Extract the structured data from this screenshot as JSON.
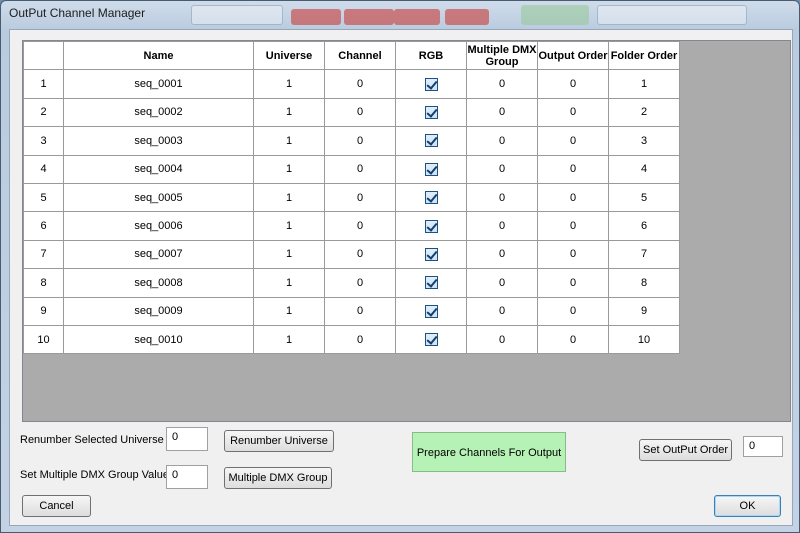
{
  "window": {
    "title": "OutPut Channel Manager"
  },
  "grid": {
    "columns": [
      "Name",
      "Universe",
      "Channel",
      "RGB",
      "Multiple DMX Group",
      "Output Order",
      "Folder Order"
    ],
    "rows": [
      {
        "num": "1",
        "name": "seq_0001",
        "universe": "1",
        "channel": "0",
        "rgb": true,
        "mdmx": "0",
        "output_order": "0",
        "folder_order": "1"
      },
      {
        "num": "2",
        "name": "seq_0002",
        "universe": "1",
        "channel": "0",
        "rgb": true,
        "mdmx": "0",
        "output_order": "0",
        "folder_order": "2"
      },
      {
        "num": "3",
        "name": "seq_0003",
        "universe": "1",
        "channel": "0",
        "rgb": true,
        "mdmx": "0",
        "output_order": "0",
        "folder_order": "3"
      },
      {
        "num": "4",
        "name": "seq_0004",
        "universe": "1",
        "channel": "0",
        "rgb": true,
        "mdmx": "0",
        "output_order": "0",
        "folder_order": "4"
      },
      {
        "num": "5",
        "name": "seq_0005",
        "universe": "1",
        "channel": "0",
        "rgb": true,
        "mdmx": "0",
        "output_order": "0",
        "folder_order": "5"
      },
      {
        "num": "6",
        "name": "seq_0006",
        "universe": "1",
        "channel": "0",
        "rgb": true,
        "mdmx": "0",
        "output_order": "0",
        "folder_order": "6"
      },
      {
        "num": "7",
        "name": "seq_0007",
        "universe": "1",
        "channel": "0",
        "rgb": true,
        "mdmx": "0",
        "output_order": "0",
        "folder_order": "7"
      },
      {
        "num": "8",
        "name": "seq_0008",
        "universe": "1",
        "channel": "0",
        "rgb": true,
        "mdmx": "0",
        "output_order": "0",
        "folder_order": "8"
      },
      {
        "num": "9",
        "name": "seq_0009",
        "universe": "1",
        "channel": "0",
        "rgb": true,
        "mdmx": "0",
        "output_order": "0",
        "folder_order": "9"
      },
      {
        "num": "10",
        "name": "seq_0010",
        "universe": "1",
        "channel": "0",
        "rgb": true,
        "mdmx": "0",
        "output_order": "0",
        "folder_order": "10"
      }
    ]
  },
  "controls": {
    "renumber_label": "Renumber Selected Universe",
    "renumber_value": "0",
    "renumber_button": "Renumber Universe",
    "dmx_label": "Set Multiple DMX Group Value",
    "dmx_value": "0",
    "dmx_button": "Multiple DMX Group",
    "prepare_button": "Prepare Channels For Output",
    "set_order_button": "Set OutPut Order",
    "set_order_value": "0",
    "cancel_button": "Cancel",
    "ok_button": "OK"
  },
  "colors": {
    "prepare_button_bg": "#b6f2b6",
    "checkbox_check": "#163e6b"
  }
}
